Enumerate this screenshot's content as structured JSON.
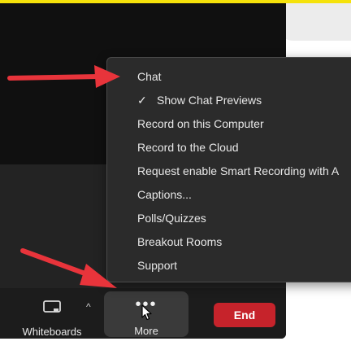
{
  "toolbar": {
    "whiteboards_label": "Whiteboards",
    "whiteboards_icon": "screen-share-icon",
    "caret": "^",
    "more_label": "More",
    "more_dots": "•••",
    "end_label": "End",
    "end_color": "#c6232b"
  },
  "menu": {
    "items": [
      {
        "label": "Chat"
      },
      {
        "label": "Show Chat Previews",
        "checked": true,
        "check": "✓"
      },
      {
        "label": "Record on this Computer"
      },
      {
        "label": "Record to the Cloud"
      },
      {
        "label": "Request enable Smart Recording with A"
      },
      {
        "label": "Captions..."
      },
      {
        "label": "Polls/Quizzes"
      },
      {
        "label": "Breakout Rooms"
      },
      {
        "label": "Support"
      }
    ]
  },
  "annotations": {
    "arrow_color": "#e8343b"
  },
  "theme": {
    "highlight_band": "#f5e20a"
  }
}
